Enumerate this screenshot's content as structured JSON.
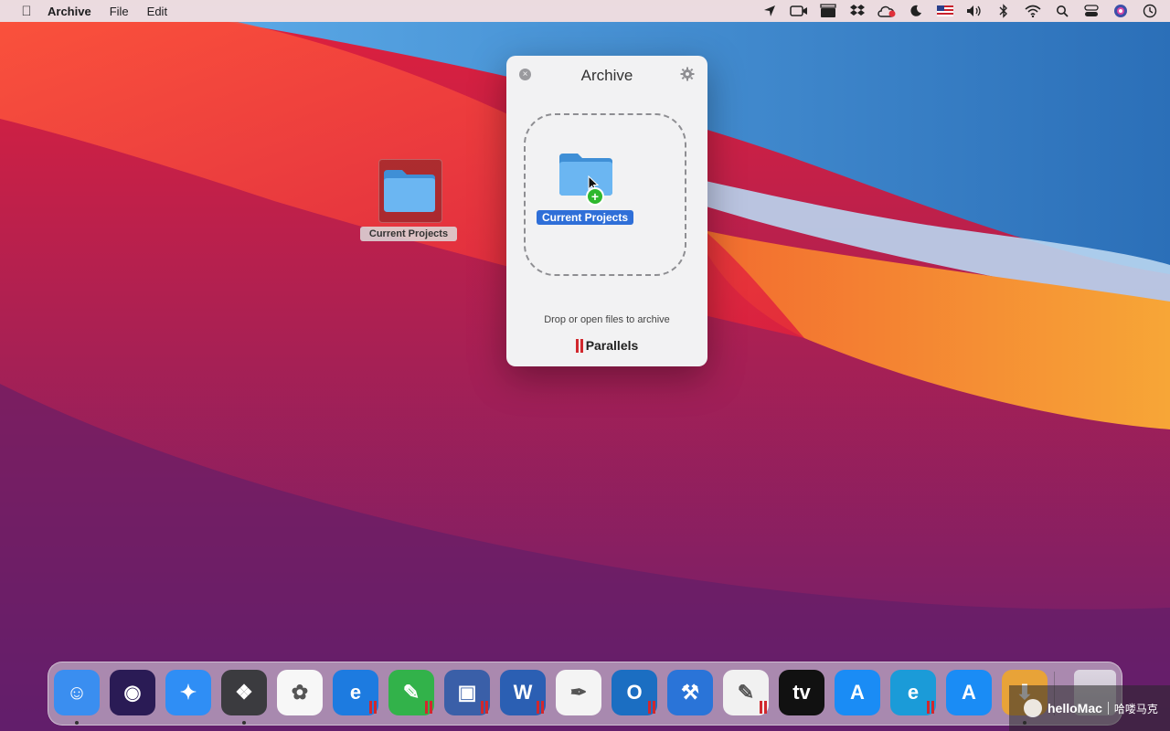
{
  "menubar": {
    "app_name": "Archive",
    "items": [
      "File",
      "Edit"
    ],
    "status_icons": [
      "location-icon",
      "facetime-icon",
      "clapper-icon",
      "dropbox-icon",
      "cloud-icon",
      "moon-icon",
      "us-flag-icon",
      "volume-icon",
      "bluetooth-icon",
      "wifi-icon",
      "search-icon",
      "control-center-icon",
      "siri-icon",
      "clock-icon"
    ]
  },
  "desktop": {
    "folder_label": "Current Projects"
  },
  "archive_window": {
    "title": "Archive",
    "drag_item_label": "Current Projects",
    "hint": "Drop or open files to archive",
    "brand": "Parallels"
  },
  "dock": {
    "apps": [
      {
        "name": "finder",
        "color": "#3a8ef0",
        "glyph": "☺",
        "dot": true
      },
      {
        "name": "siri",
        "color": "#2a1b55",
        "glyph": "◉",
        "dot": false
      },
      {
        "name": "safari",
        "color": "#2f8ef5",
        "glyph": "✦",
        "dot": false
      },
      {
        "name": "final-cut",
        "color": "#3b3b3f",
        "glyph": "❖",
        "dot": true
      },
      {
        "name": "photos",
        "color": "#f7f7f7",
        "glyph": "✿",
        "dot": false
      },
      {
        "name": "internet-explorer",
        "color": "#1d7be0",
        "glyph": "e",
        "dot": false,
        "parallels": true
      },
      {
        "name": "parallels-app",
        "color": "#32b24a",
        "glyph": "✎",
        "dot": false,
        "parallels": true
      },
      {
        "name": "windows-vm",
        "color": "#3a5fa8",
        "glyph": "▣",
        "dot": false,
        "parallels": true
      },
      {
        "name": "word",
        "color": "#2b5fb3",
        "glyph": "W",
        "dot": false,
        "parallels": true
      },
      {
        "name": "pages",
        "color": "#f4f4f4",
        "glyph": "✒",
        "dot": false
      },
      {
        "name": "outlook",
        "color": "#1b6ec2",
        "glyph": "O",
        "dot": false,
        "parallels": true
      },
      {
        "name": "xcode",
        "color": "#2a74d8",
        "glyph": "⚒",
        "dot": false
      },
      {
        "name": "paint",
        "color": "#f1f1f1",
        "glyph": "✎",
        "dot": false,
        "parallels": true
      },
      {
        "name": "apple-tv",
        "color": "#111111",
        "glyph": "tv",
        "dot": false
      },
      {
        "name": "app-store",
        "color": "#1a8cf5",
        "glyph": "A",
        "dot": false
      },
      {
        "name": "edge",
        "color": "#1b9bd8",
        "glyph": "e",
        "dot": false,
        "parallels": true
      },
      {
        "name": "app-store-2",
        "color": "#1a8cf5",
        "glyph": "A",
        "dot": false
      },
      {
        "name": "downloads",
        "color": "#e8a338",
        "glyph": "⬇",
        "dot": true
      }
    ]
  },
  "watermark": {
    "text": "helloMac",
    "text_cn": "哈喽马克"
  }
}
